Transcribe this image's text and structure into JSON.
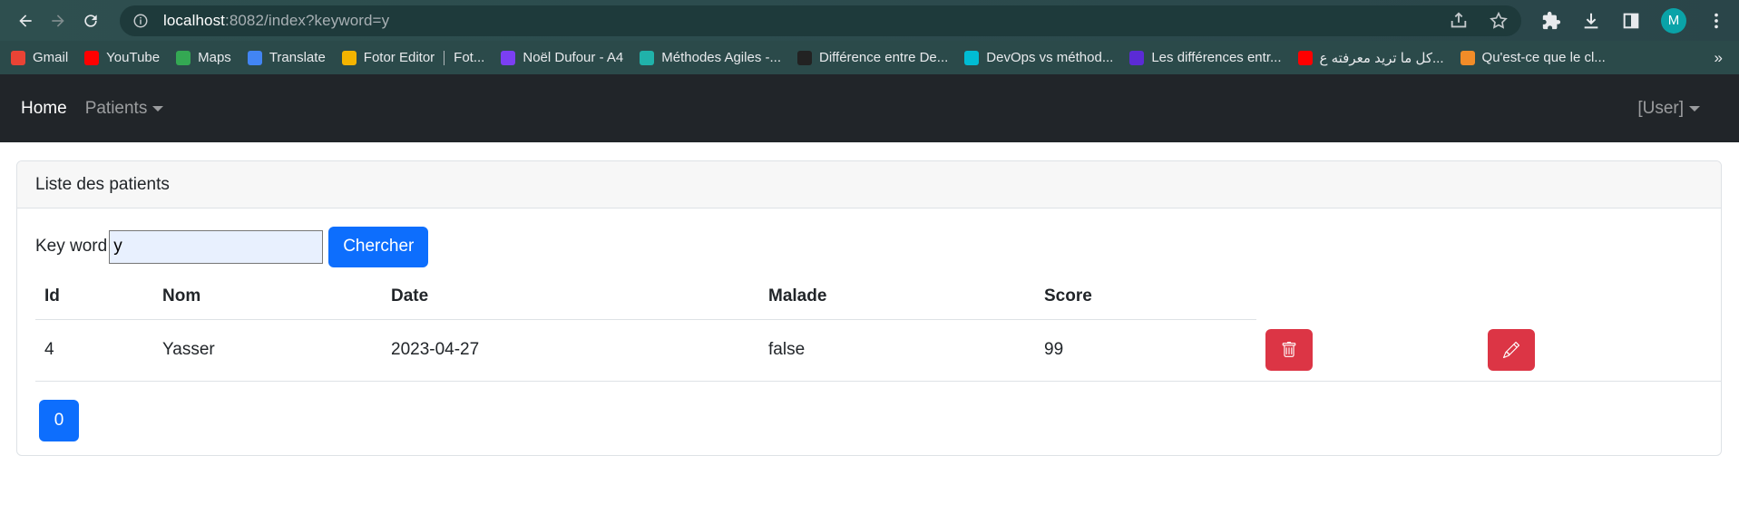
{
  "browser": {
    "url_host": "localhost",
    "url_rest": ":8082/index?keyword=y",
    "profile_initial": "M",
    "bookmarks": [
      {
        "label": "Gmail",
        "color": "#ea4335"
      },
      {
        "label": "YouTube",
        "color": "#ff0000"
      },
      {
        "label": "Maps",
        "color": "#34a853"
      },
      {
        "label": "Translate",
        "color": "#4285f4"
      },
      {
        "label": "Fotor Editor",
        "color": "#f4b400"
      },
      {
        "label": "Fot...",
        "color": ""
      },
      {
        "label": "Noël Dufour - A4",
        "color": "#7b3ff2"
      },
      {
        "label": "Méthodes Agiles -...",
        "color": "#20b2aa"
      },
      {
        "label": "Différence entre De...",
        "color": "#222222"
      },
      {
        "label": "DevOps vs méthod...",
        "color": "#00bcd4"
      },
      {
        "label": "Les différences entr...",
        "color": "#5b2bd6"
      },
      {
        "label": "كل ما تريد معرفته ع...",
        "color": "#ff0000"
      },
      {
        "label": "Qu'est-ce que le cl...",
        "color": "#f28c28"
      }
    ],
    "more": "»"
  },
  "navbar": {
    "home": "Home",
    "patients": "Patients",
    "user": "[User]"
  },
  "card": {
    "title": "Liste des patients",
    "search": {
      "label": "Key word",
      "value": "y",
      "button": "Chercher"
    },
    "table": {
      "headers": [
        "Id",
        "Nom",
        "Date",
        "Malade",
        "Score"
      ],
      "rows": [
        {
          "id": "4",
          "nom": "Yasser",
          "date": "2023-04-27",
          "malade": "false",
          "score": "99"
        }
      ]
    },
    "pages": [
      "0"
    ]
  },
  "colors": {
    "primary": "#0d6efd",
    "danger": "#dc3545",
    "navbar": "#212529"
  }
}
